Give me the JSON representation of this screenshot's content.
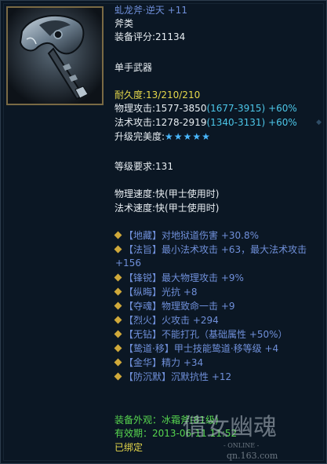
{
  "item": {
    "name": "虬龙斧·逆天 +11",
    "type": "斧类",
    "score": "装备评分:21134",
    "slot": "单手武器",
    "durability": "耐久度:13/210/210",
    "phys_attack_base": "物理攻击:1577-3850",
    "phys_attack_bonus": "(1677-3915)",
    "phys_attack_pct": "+60%",
    "magic_attack_base": "法术攻击:1278-2919",
    "magic_attack_bonus": "(1340-3131)",
    "magic_attack_pct": "+60%",
    "perfection_label": "升级完美度:",
    "perfection_stars": "★★★★★",
    "level_req": "等级要求:131",
    "phys_speed": "物理速度:快(甲士使用时)",
    "magic_speed": "法术速度:快(甲士使用时)"
  },
  "affixes": [
    "【地藏】对地狱道伤害 +30.8%",
    "【法旨】最小法术攻击 +63，最大法术攻击 +156",
    "【锋锐】最大物理攻击 +9%",
    "【纵晦】光抗 +8",
    "【夺魂】物理致命一击 +9",
    "【烈火】火攻击 +294",
    "【无钻】不能打孔（基础属性 +50%）",
    "【鸷道·移】甲士技能鸷道·移等级 +4",
    "【金华】精力 +34",
    "【防沉默】沉默抗性 +12"
  ],
  "footer": {
    "appearance": "装备外观：冰霜斧(81级)",
    "expiry": "有效期：2013-06-11 11:52",
    "bound": "已绑定"
  },
  "watermark": {
    "logo": "倩女幽魂",
    "online": "- ONLINE -",
    "site": "qn.163.com"
  },
  "colors": {
    "background": "#0b1724",
    "name": "#6f8fd9",
    "durability": "#e6d84a",
    "bonus": "#4cc6e8",
    "stars": "#49b8ff",
    "footer": "#57d64f"
  }
}
